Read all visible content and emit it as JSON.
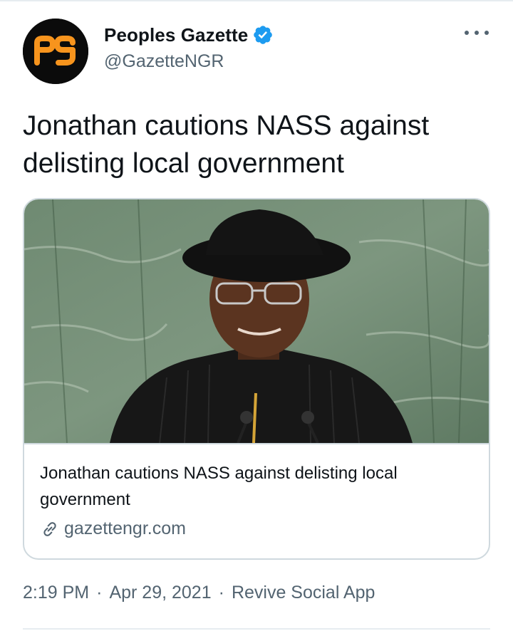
{
  "author": {
    "display_name": "Peoples Gazette",
    "handle": "@GazetteNGR",
    "avatar_text": "pg",
    "avatar_colors": {
      "background": "#0b0b0b",
      "logo": "#f7941d"
    },
    "verified": true
  },
  "tweet": {
    "text": "Jonathan cautions NASS against delisting local government"
  },
  "card": {
    "title": "Jonathan cautions NASS against delisting local government",
    "domain": "gazettengr.com",
    "link_icon": "link-icon",
    "image_description_icon": "photo"
  },
  "meta": {
    "time": "2:19 PM",
    "separator": "·",
    "date": "Apr 29, 2021",
    "source": "Revive Social App"
  },
  "colors": {
    "text": "#0f1419",
    "secondary": "#536471",
    "verified_blue": "#1d9bf0",
    "border": "#cfd9de"
  }
}
